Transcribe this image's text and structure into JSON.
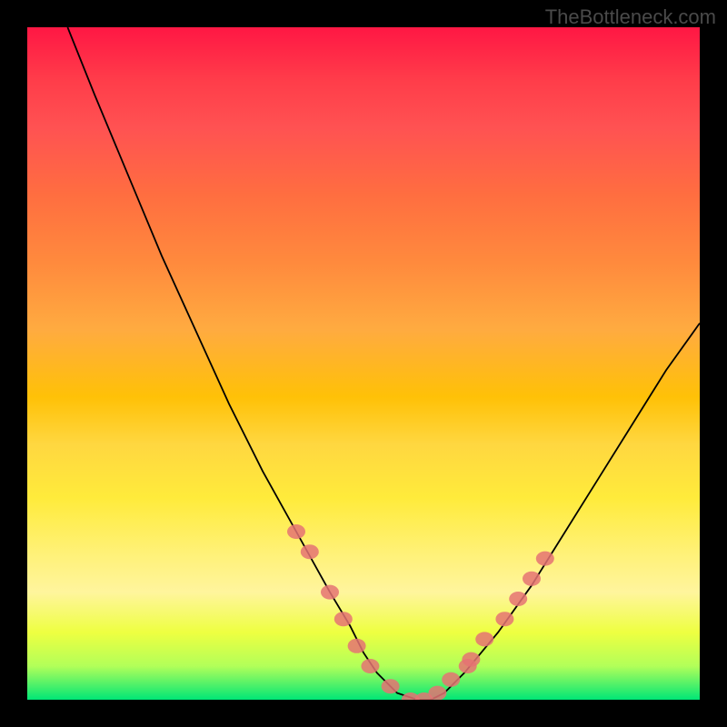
{
  "watermark": "TheBottleneck.com",
  "chart_data": {
    "type": "line",
    "title": "",
    "xlabel": "",
    "ylabel": "",
    "xlim": [
      0,
      100
    ],
    "ylim": [
      0,
      100
    ],
    "grid": false,
    "legend": false,
    "series": [
      {
        "name": "curve",
        "x": [
          6,
          10,
          15,
          20,
          25,
          30,
          35,
          40,
          45,
          48,
          50,
          52,
          55,
          58,
          60,
          62,
          65,
          70,
          75,
          80,
          85,
          90,
          95,
          100
        ],
        "y": [
          100,
          90,
          78,
          66,
          55,
          44,
          34,
          25,
          16,
          11,
          7,
          4,
          1,
          0,
          0,
          1,
          4,
          10,
          17,
          25,
          33,
          41,
          49,
          56
        ]
      }
    ],
    "markers": [
      {
        "x": 40,
        "y": 25
      },
      {
        "x": 42,
        "y": 22
      },
      {
        "x": 45,
        "y": 16
      },
      {
        "x": 47,
        "y": 12
      },
      {
        "x": 49,
        "y": 8
      },
      {
        "x": 51,
        "y": 5
      },
      {
        "x": 54,
        "y": 2
      },
      {
        "x": 57,
        "y": 0
      },
      {
        "x": 59,
        "y": 0
      },
      {
        "x": 61,
        "y": 1
      },
      {
        "x": 63,
        "y": 3
      },
      {
        "x": 65.5,
        "y": 5
      },
      {
        "x": 66,
        "y": 6
      },
      {
        "x": 68,
        "y": 9
      },
      {
        "x": 71,
        "y": 12
      },
      {
        "x": 73,
        "y": 15
      },
      {
        "x": 75,
        "y": 18
      },
      {
        "x": 77,
        "y": 21
      }
    ]
  }
}
